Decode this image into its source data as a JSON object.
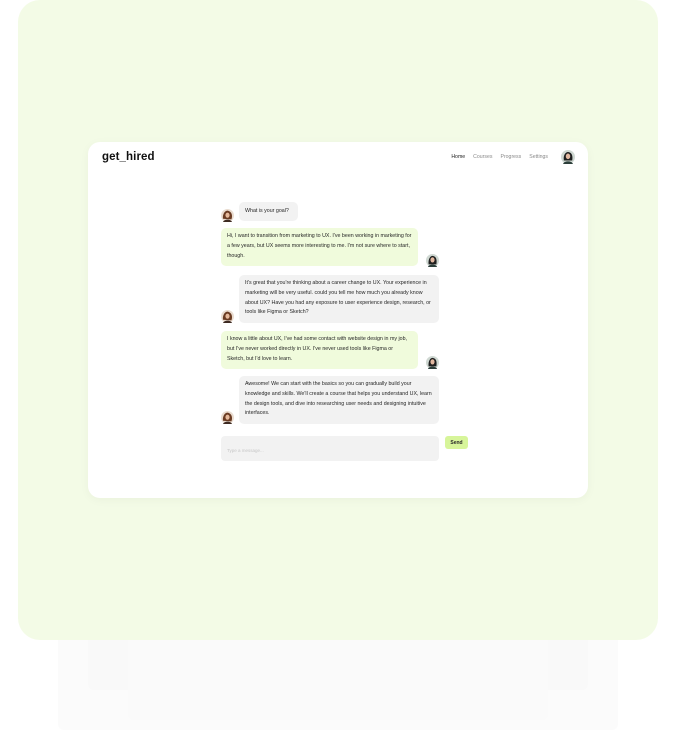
{
  "app": {
    "logo": "get_hired"
  },
  "nav": {
    "items": [
      "Home",
      "Courses",
      "Progress",
      "Settings"
    ],
    "active": "Home"
  },
  "chat": {
    "messages": [
      {
        "role": "bot",
        "text": "What is your goal?"
      },
      {
        "role": "user",
        "text": "Hi, I want to transition from marketing to UX. I've been working in marketing for a few years, but UX seems more interesting to me. I'm not sure where to start, though."
      },
      {
        "role": "bot",
        "text": "It's great that you're thinking about a career change to UX. Your experience in marketing will be very useful. could you tell me how much you already know about UX? Have you had any exposure to user experience design, research, or tools like Figma or Sketch?"
      },
      {
        "role": "user",
        "text": "I know a little about UX, I've had some contact with website design in my job, but I've never worked directly in UX. I've never used tools like Figma or Sketch, but I'd love to learn."
      },
      {
        "role": "bot",
        "text": "Awesome! We can start with the basics so you can gradually build your knowledge and skills. We'll create a course that helps you understand UX, learn the design tools, and dive into researching user needs and designing intuitive interfaces."
      }
    ]
  },
  "composer": {
    "placeholder": "Type a message...",
    "send_label": "Send"
  },
  "colors": {
    "stage_bg": "#f3fbe6",
    "user_bubble": "#f0fbdc",
    "bot_bubble": "#f2f2f2",
    "send_button": "#d7f59a"
  },
  "icons": {
    "bot_avatar": "assistant-avatar-icon",
    "user_avatar": "user-avatar-icon"
  }
}
